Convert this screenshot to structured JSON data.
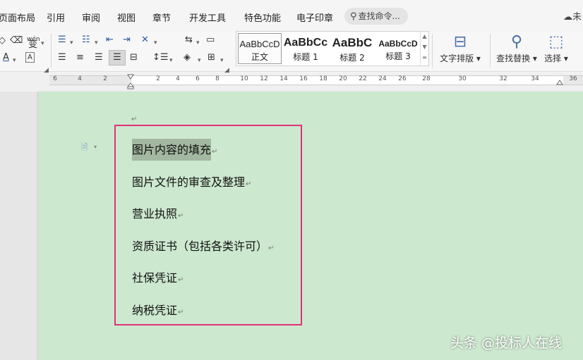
{
  "menu": {
    "items": [
      "页面布局",
      "引用",
      "审阅",
      "视图",
      "章节",
      "开发工具",
      "特色功能",
      "电子印章"
    ],
    "search_placeholder": "查找命令...",
    "cloud_label": "未"
  },
  "ribbon": {
    "styles": [
      {
        "sample": "AaBbCcD",
        "name": "正文"
      },
      {
        "sample": "AaBbCc",
        "name": "标题 1"
      },
      {
        "sample": "AaBbC",
        "name": "标题 2"
      },
      {
        "sample": "AaBbCcD",
        "name": "标题 3"
      }
    ],
    "text_layout_label": "文字排版",
    "find_replace_label": "查找替换",
    "select_label": "选择",
    "phonetic_label": "wén"
  },
  "ruler": {
    "ticks": [
      "6",
      "4",
      "2",
      "2",
      "4",
      "6",
      "8",
      "10",
      "12",
      "14",
      "16",
      "18",
      "20",
      "22",
      "24",
      "26",
      "28",
      "30",
      "32",
      "34",
      "36"
    ]
  },
  "document": {
    "lines": [
      "图片内容的填充",
      "图片文件的审查及整理",
      "营业执照",
      "资质证书（包括各类许可）",
      "社保凭证",
      "纳税凭证"
    ],
    "paragraph_mark": "↵"
  },
  "watermark": "头条 @投标人在线",
  "colors": {
    "page_background": "#cce8cf",
    "selection_frame": "#e0307a",
    "highlight": "#a3b8a0"
  }
}
